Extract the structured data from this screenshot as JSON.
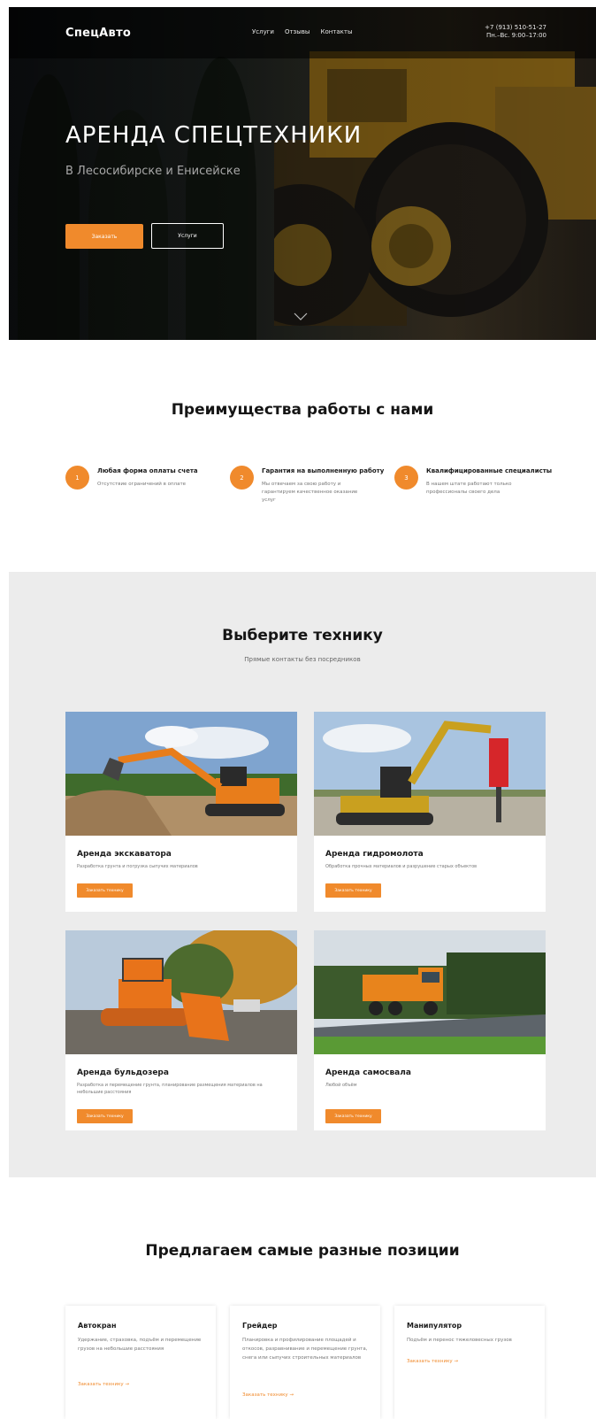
{
  "header": {
    "logo": "СпецАвто",
    "nav": [
      "Услуги",
      "Отзывы",
      "Контакты"
    ],
    "phone": "+7 (913) 510-51-27",
    "hours": "Пн.–Вс. 9:00–17:00"
  },
  "hero": {
    "title": "АРЕНДА СПЕЦТЕХНИКИ",
    "subtitle": "В Лесосибирске и Енисейске",
    "order_button": "Заказать",
    "services_button": "Услуги"
  },
  "advantages": {
    "title": "Преимущества работы с нами",
    "items": [
      {
        "num": "1",
        "title": "Любая форма оплаты счета",
        "text": "Отсутствие ограничений в оплате"
      },
      {
        "num": "2",
        "title": "Гарантия на выполненную работу",
        "text": "Мы отвечаем за свою работу и гарантируем качественное оказание услуг"
      },
      {
        "num": "3",
        "title": "Квалифицированные специалисты",
        "text": "В нашем штате работают только профессионалы своего дела"
      }
    ]
  },
  "choose": {
    "title": "Выберите технику",
    "subtitle": "Прямые контакты без посредников",
    "cards": [
      {
        "title": "Аренда экскаватора",
        "text": "Разработка грунта и погрузка сыпучих материалов",
        "button": "Заказать технику"
      },
      {
        "title": "Аренда гидромолота",
        "text": "Обработка прочных материалов и разрушение старых объектов",
        "button": "Заказать технику"
      },
      {
        "title": "Аренда бульдозера",
        "text": "Разработка и перемещение грунта, планирование размещения материалов на небольшие расстояния",
        "button": "Заказать технику"
      },
      {
        "title": "Аренда самосвала",
        "text": "Любой объём",
        "button": "Заказать технику"
      }
    ]
  },
  "positions": {
    "title": "Предлагаем самые разные позиции",
    "items": [
      {
        "title": "Автокран",
        "text": "Удержание, страховка, подъём и перемещение грузов на небольшие расстояния",
        "link": "Заказать технику →"
      },
      {
        "title": "Грейдер",
        "text": "Планировка и профилирование площадей и откосов, разравнивание и перемещение грунта, снега или сыпучих строительных материалов",
        "link": "Заказать технику →"
      },
      {
        "title": "Манипулятор",
        "text": "Подъём и перенос тяжеловесных грузов",
        "link": "Заказать технику →"
      }
    ]
  },
  "colors": {
    "accent": "#f08a2c",
    "section_gray": "#ececec"
  }
}
